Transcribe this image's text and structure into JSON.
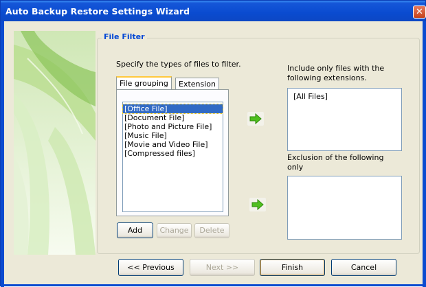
{
  "window": {
    "title": "Auto Backup Restore Settings Wizard",
    "close_glyph": "✕"
  },
  "group": {
    "legend": "File Filter"
  },
  "instructions": {
    "specify": "Specify the types of files to filter."
  },
  "tabs": [
    {
      "label": "File grouping"
    },
    {
      "label": "Extension"
    }
  ],
  "file_groups": [
    "[Office File]",
    "[Document File]",
    "[Photo and Picture File]",
    "[Music File]",
    "[Movie and Video File]",
    "[Compressed files]"
  ],
  "include": {
    "label_line1": "Include only files with the",
    "label_line2": "following extensions.",
    "items": [
      "[All Files]"
    ]
  },
  "exclude": {
    "label_line1": "Exclusion of the following",
    "label_line2": "only",
    "items": []
  },
  "list_buttons": {
    "add": "Add",
    "change": "Change",
    "delete": "Delete"
  },
  "nav_buttons": {
    "previous": "<< Previous",
    "next": "Next >>",
    "finish": "Finish",
    "cancel": "Cancel"
  },
  "icons": {
    "include_arrow": "green-right-arrow-icon",
    "exclude_arrow": "green-right-arrow-icon"
  }
}
